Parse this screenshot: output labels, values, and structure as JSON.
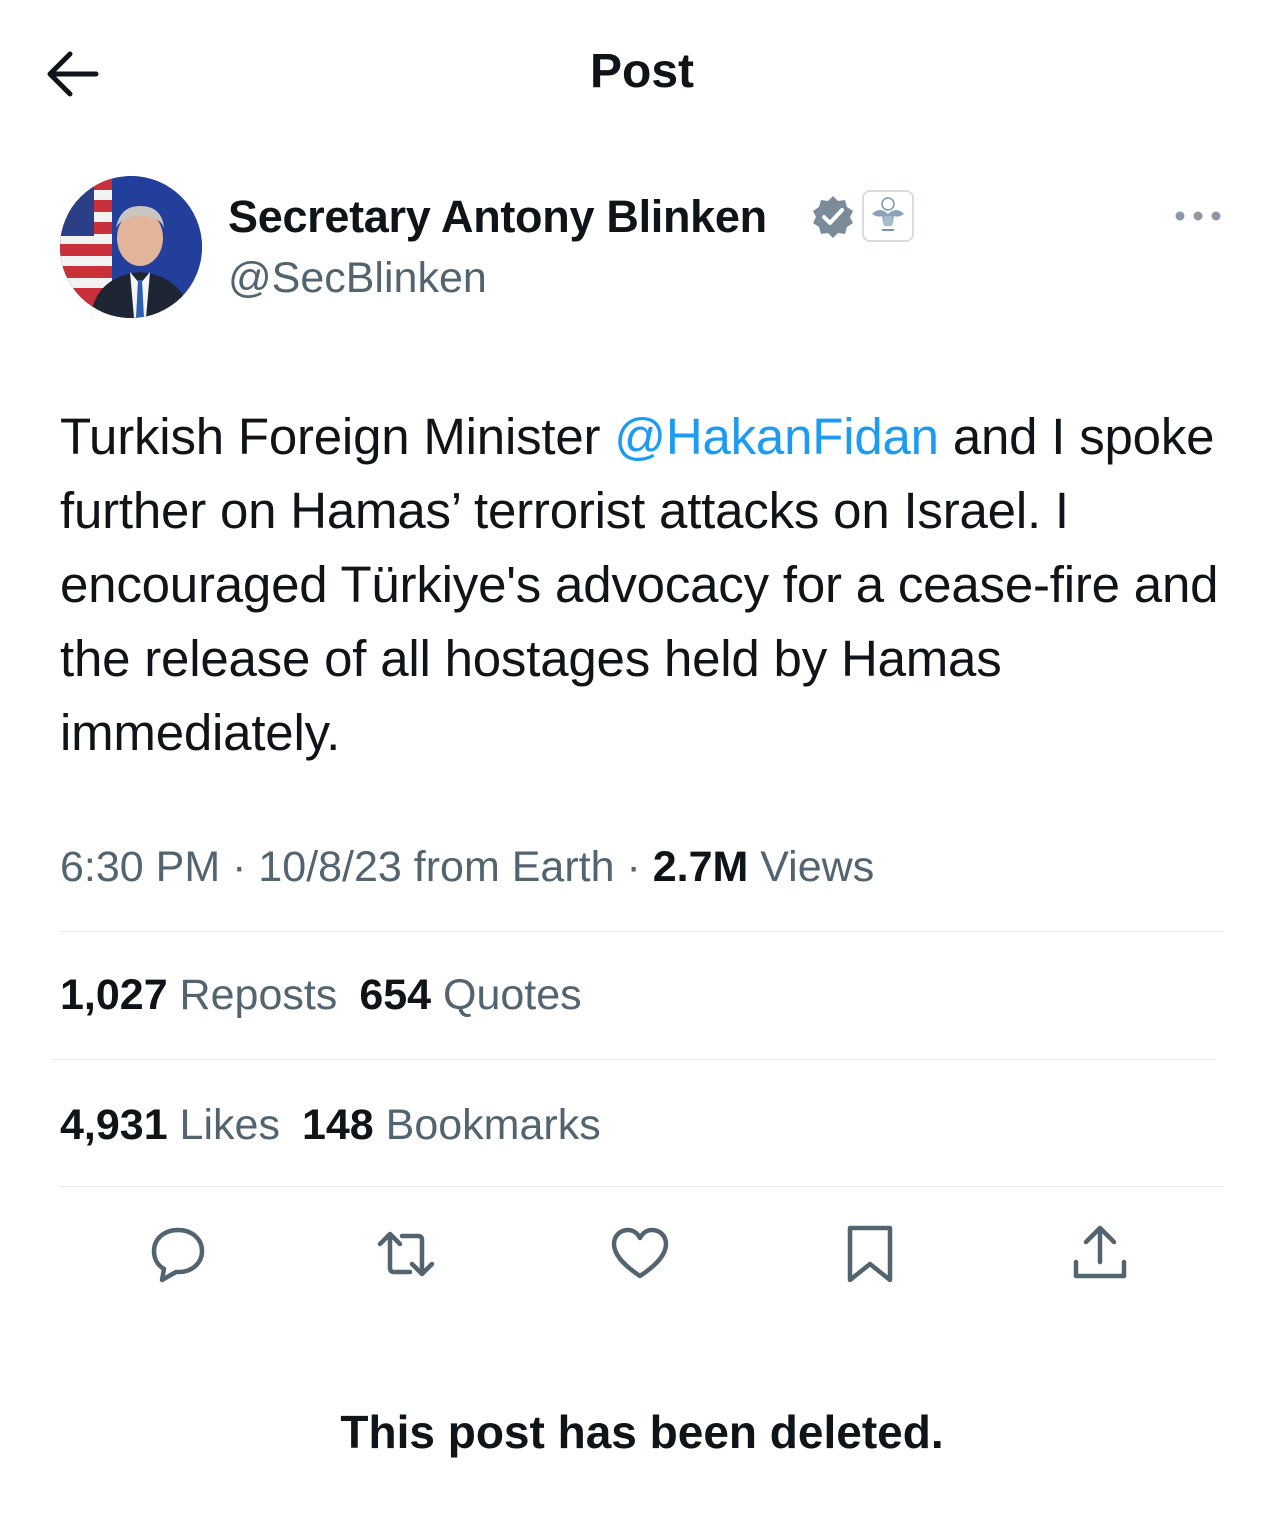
{
  "header": {
    "title": "Post",
    "back_icon": "arrow-left-icon"
  },
  "author": {
    "name": "Secretary Antony Blinken",
    "handle": "@SecBlinken",
    "verified_icon": "verified-badge-icon",
    "affiliation_icon": "us-state-department-seal-icon",
    "more_icon": "more-options-icon"
  },
  "post": {
    "text_before_mention": "Turkish Foreign Minister ",
    "mention": "@HakanFidan",
    "text_after_mention": " and I spoke further on Hamas’ terrorist attacks on Israel. I encouraged Türkiye's advocacy for a cease-fire and the release of all hostages held by Hamas immediately."
  },
  "meta": {
    "time": "6:30 PM",
    "separator": " · ",
    "date_source": "10/8/23 from Earth",
    "views_count": "2.7M",
    "views_label": " Views"
  },
  "stats": {
    "reposts_count": "1,027",
    "reposts_label": " Reposts",
    "quotes_count": "654",
    "quotes_label": " Quotes",
    "likes_count": "4,931",
    "likes_label": " Likes",
    "bookmarks_count": "148",
    "bookmarks_label": " Bookmarks"
  },
  "actions": [
    "reply-icon",
    "repost-icon",
    "like-icon",
    "bookmark-icon",
    "share-icon"
  ],
  "notice": "This post has been deleted.",
  "colors": {
    "text": "#0f1419",
    "secondary": "#536471",
    "link": "#1d9bf0",
    "divider": "#e3e7ea"
  }
}
